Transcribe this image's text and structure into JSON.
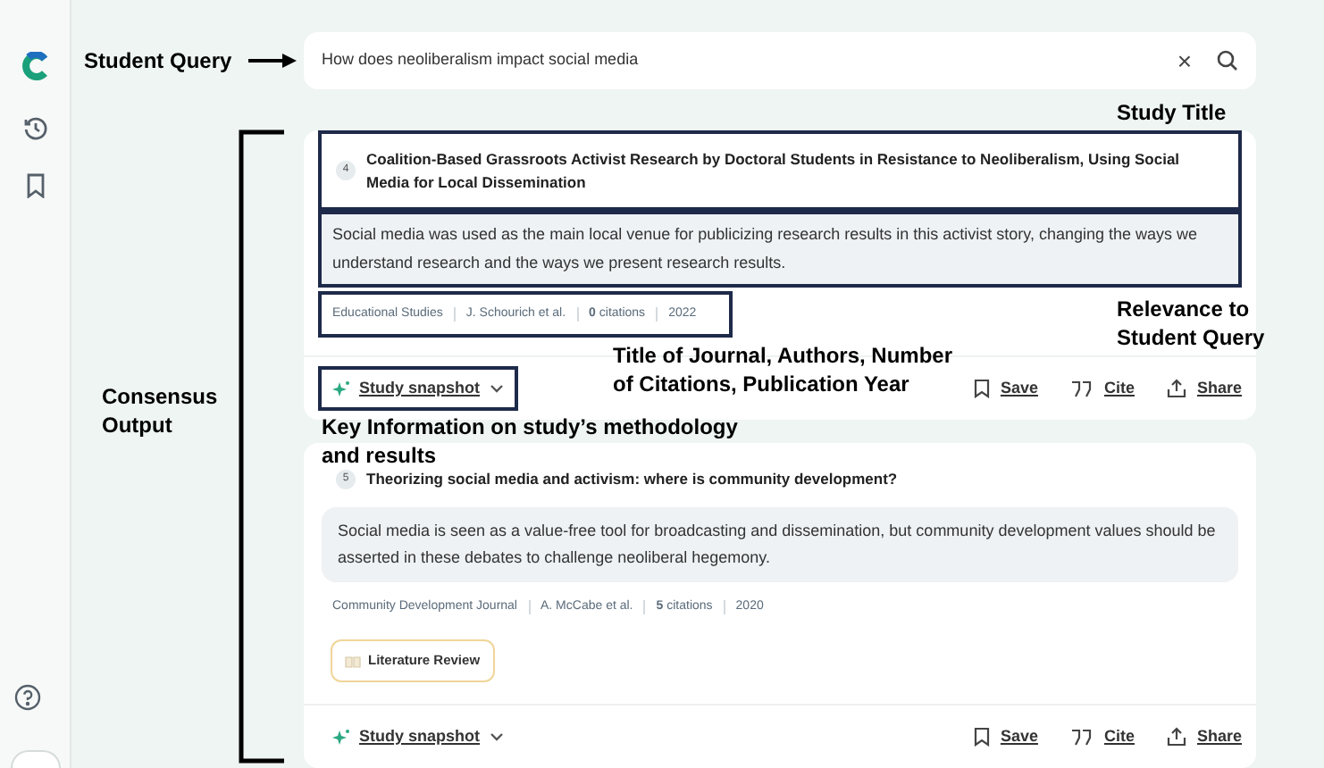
{
  "search": {
    "value": "How does neoliberalism impact social media",
    "clear_icon": "×"
  },
  "results": [
    {
      "number": "4",
      "title": "Coalition-Based Grassroots Activist Research by Doctoral Students in Resistance to Neoliberalism, Using Social Media for Local Dissemination",
      "summary": "Social media was used as the main local venue for publicizing research results in this activist story, changing the ways we understand research and the ways we present research results.",
      "meta": [
        "Educational Studies",
        "J. Schourich et al.",
        "**0** citations",
        "2022"
      ],
      "snapshot": "Study snapshot",
      "actions": [
        "Save",
        "Cite",
        "Share"
      ],
      "annotated": true
    },
    {
      "number": "5",
      "title": "Theorizing social media and activism: where is community development?",
      "summary": "Social media is seen as a value-free tool for broadcasting and dissemination, but community development values should be asserted in these debates to challenge neoliberal hegemony.",
      "meta": [
        "Community Development Journal",
        "A. McCabe et al.",
        "**5** citations",
        "2020"
      ],
      "tag": "Literature Review",
      "snapshot": "Study snapshot",
      "actions": [
        "Save",
        "Cite",
        "Share"
      ],
      "annotated": false
    }
  ],
  "annotations": [
    {
      "kind": "query",
      "text": "Student Query"
    },
    {
      "kind": "title",
      "text": "Study Title"
    },
    {
      "kind": "relevance",
      "text": "Relevance to Student Query"
    },
    {
      "kind": "meta",
      "text": "Title of Journal, Authors, Number of Citations, Publication Year"
    },
    {
      "kind": "snapshot",
      "text": "Key Information on study’s methodology and results"
    },
    {
      "kind": "output",
      "text": "Consensus Output"
    }
  ]
}
